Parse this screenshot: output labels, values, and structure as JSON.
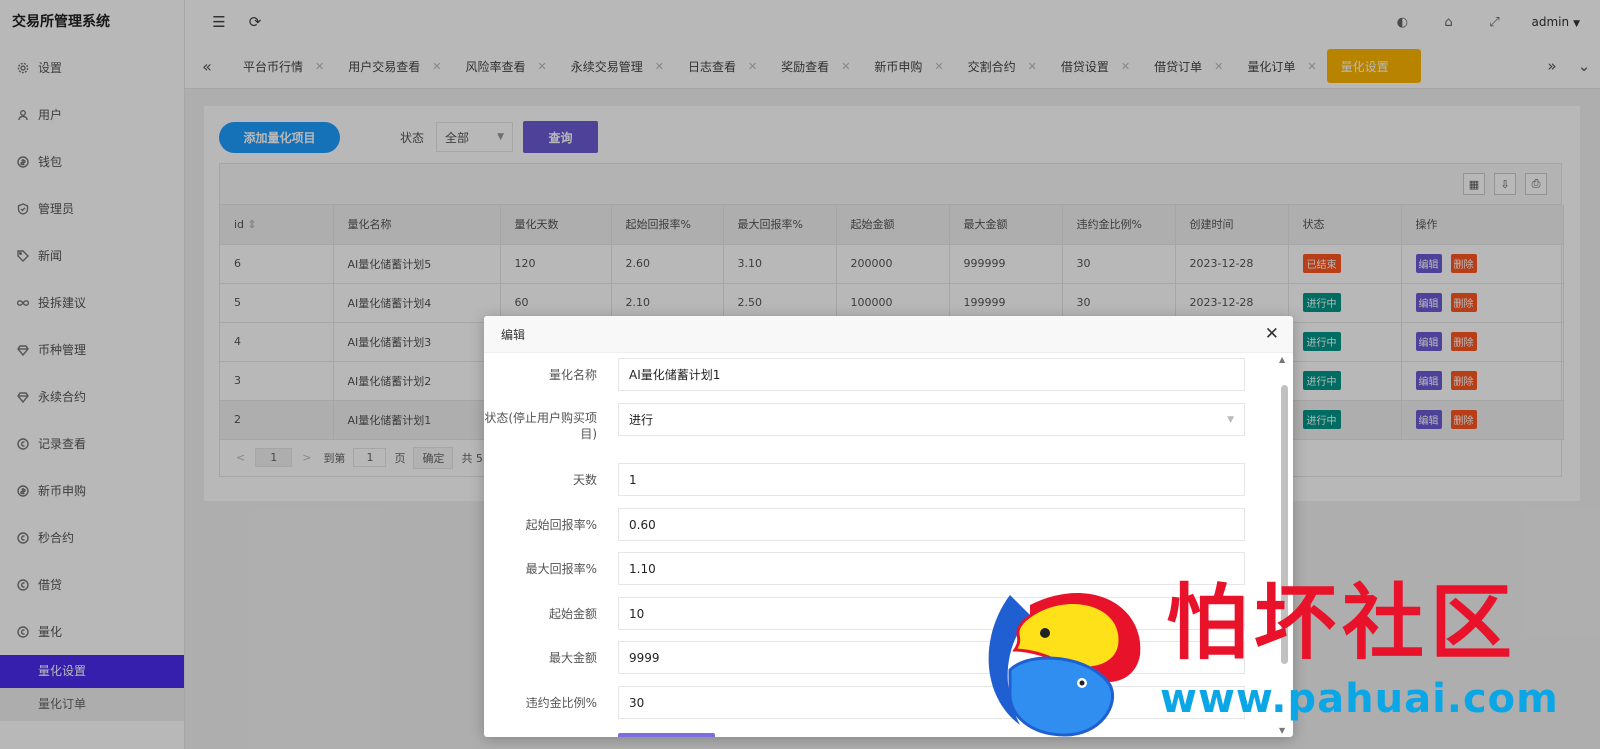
{
  "app": {
    "title": "交易所管理系统"
  },
  "sidebar": {
    "items": [
      {
        "label": "设置",
        "icon": "gear-icon"
      },
      {
        "label": "用户",
        "icon": "user-icon"
      },
      {
        "label": "钱包",
        "icon": "coin-icon"
      },
      {
        "label": "管理员",
        "icon": "shield-icon"
      },
      {
        "label": "新闻",
        "icon": "tag-icon"
      },
      {
        "label": "投拆建议",
        "icon": "infinity-icon"
      },
      {
        "label": "币种管理",
        "icon": "diamond-icon"
      },
      {
        "label": "永续合约",
        "icon": "diamond-icon"
      },
      {
        "label": "记录查看",
        "icon": "circle-icon"
      },
      {
        "label": "新币申购",
        "icon": "coin-icon"
      },
      {
        "label": "秒合约",
        "icon": "circle-icon"
      },
      {
        "label": "借贷",
        "icon": "circle-icon"
      },
      {
        "label": "量化",
        "icon": "circle-icon"
      }
    ],
    "submenu": [
      {
        "label": "量化设置",
        "active": true
      },
      {
        "label": "量化订单",
        "active": false
      }
    ]
  },
  "header": {
    "user": "admin"
  },
  "tabs": [
    "平台币行情",
    "用户交易查看",
    "风险率查看",
    "永续交易管理",
    "日志查看",
    "奖励查看",
    "新币申购",
    "交割合约",
    "借贷设置",
    "借贷订单",
    "量化订单",
    "量化设置"
  ],
  "toolbar": {
    "add_label": "添加量化项目",
    "status_label": "状态",
    "status_value": "全部",
    "query_label": "查询"
  },
  "table": {
    "columns": [
      "id",
      "量化名称",
      "量化天数",
      "起始回报率%",
      "最大回报率%",
      "起始金额",
      "最大金额",
      "违约金比例%",
      "创建时间",
      "状态",
      "操作"
    ],
    "rows": [
      {
        "id": "6",
        "name": "AI量化储蓄计划5",
        "days": "120",
        "start_rate": "2.60",
        "max_rate": "3.10",
        "start_amt": "200000",
        "max_amt": "999999",
        "penalty": "30",
        "created": "2023-12-28",
        "status": "已结束"
      },
      {
        "id": "5",
        "name": "AI量化储蓄计划4",
        "days": "60",
        "start_rate": "2.10",
        "max_rate": "2.50",
        "start_amt": "100000",
        "max_amt": "199999",
        "penalty": "30",
        "created": "2023-12-28",
        "status": "进行中"
      },
      {
        "id": "4",
        "name": "AI量化储蓄计划3",
        "status": "进行中"
      },
      {
        "id": "3",
        "name": "AI量化储蓄计划2",
        "status": "进行中"
      },
      {
        "id": "2",
        "name": "AI量化储蓄计划1",
        "status": "进行中"
      }
    ],
    "edit_label": "编辑",
    "delete_label": "删除"
  },
  "pager": {
    "current_page": "1",
    "goto_label": "到第",
    "goto_value": "1",
    "page_unit": "页",
    "confirm_label": "确定",
    "total_text": "共 5 条"
  },
  "modal": {
    "title": "编辑",
    "fields": [
      {
        "label": "量化名称",
        "value": "AI量化储蓄计划1"
      },
      {
        "label": "状态(停止用户购买项目)",
        "value": "进行"
      },
      {
        "label": "天数",
        "value": "1"
      },
      {
        "label": "起始回报率%",
        "value": "0.60"
      },
      {
        "label": "最大回报率%",
        "value": "1.10"
      },
      {
        "label": "起始金额",
        "value": "10"
      },
      {
        "label": "最大金额",
        "value": "9999"
      },
      {
        "label": "违约金比例%",
        "value": "30"
      }
    ]
  },
  "watermark": {
    "text": "怕坏社区",
    "url": "www.pahuai.com"
  },
  "colors": {
    "primary": "#1e9fff",
    "query": "#6b5bd6",
    "active_tab": "#ffb800",
    "menu_active": "#4b2bf0",
    "badge_end": "#ff5722",
    "badge_run": "#009688"
  }
}
